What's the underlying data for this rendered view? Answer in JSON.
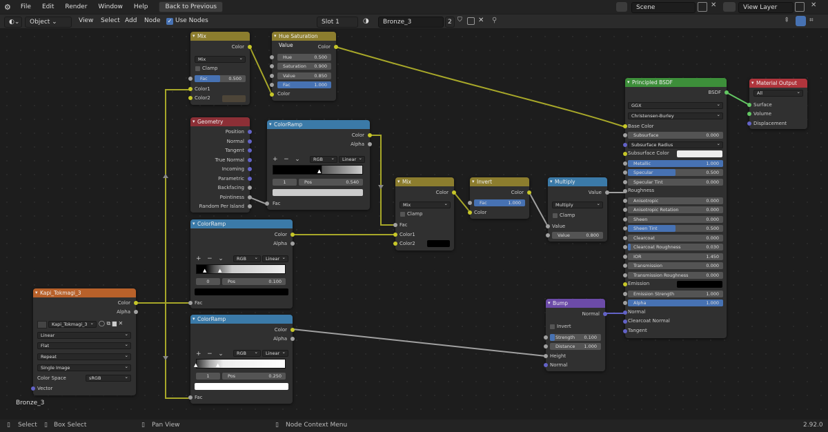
{
  "topbar": {
    "menus": [
      "File",
      "Edit",
      "Render",
      "Window",
      "Help"
    ],
    "back": "Back to Previous",
    "scene": "Scene",
    "view_layer": "View Layer"
  },
  "header": {
    "mode": "Object",
    "menus": [
      "View",
      "Select",
      "Add",
      "Node"
    ],
    "use_nodes": "Use Nodes",
    "slot": "Slot 1",
    "material": "Bronze_3",
    "users": "2"
  },
  "material_name": "Bronze_3",
  "status": {
    "select": "Select",
    "box_select": "Box Select",
    "pan_view": "Pan View",
    "context_menu": "Node Context Menu",
    "version": "2.92.0"
  },
  "colors": {
    "mix": "#8c7d2e",
    "ramp": "#3b7aa8",
    "geometry": "#8c2f36",
    "image": "#b8612a",
    "bsdf": "#3d8f3a",
    "output": "#b0353c",
    "bump": "#6c4ba8"
  },
  "nodes": {
    "mix1": {
      "title": "Mix",
      "color": "Color",
      "blend": "Mix",
      "clamp": "Clamp",
      "fac": "Fac",
      "fac_val": "0.500",
      "fac_frac": 0.5,
      "c1": "Color1",
      "c2": "Color2"
    },
    "hsv": {
      "title": "Hue Saturation Value",
      "color_out": "Color",
      "hue": "Hue",
      "hue_v": "0.500",
      "sat": "Saturation",
      "sat_v": "0.900",
      "val": "Value",
      "val_v": "0.850",
      "fac": "Fac",
      "fac_v": "1.000",
      "color_in": "Color"
    },
    "geo": {
      "title": "Geometry",
      "outs": [
        "Position",
        "Normal",
        "Tangent",
        "True Normal",
        "Incoming",
        "Parametric",
        "Backfacing",
        "Pointiness",
        "Random Per Island"
      ]
    },
    "ramp1": {
      "title": "ColorRamp",
      "color": "Color",
      "alpha": "Alpha",
      "mode": "RGB",
      "interp": "Linear",
      "idx": "1",
      "pos": "Pos",
      "pos_v": "0.540",
      "fac": "Fac"
    },
    "ramp2": {
      "title": "ColorRamp",
      "color": "Color",
      "alpha": "Alpha",
      "mode": "RGB",
      "interp": "Linear",
      "idx": "0",
      "pos": "Pos",
      "pos_v": "0.100",
      "fac": "Fac"
    },
    "ramp3": {
      "title": "ColorRamp",
      "color": "Color",
      "alpha": "Alpha",
      "mode": "RGB",
      "interp": "Linear",
      "idx": "1",
      "pos": "Pos",
      "pos_v": "0.250",
      "fac": "Fac"
    },
    "img": {
      "title": "Kapi_Tokmagi_3",
      "color": "Color",
      "alpha": "Alpha",
      "image": "Kapi_Tokmagi_3",
      "interp": "Linear",
      "proj": "Flat",
      "ext": "Repeat",
      "src": "Single Image",
      "cs_label": "Color Space",
      "cs": "sRGB",
      "vector": "Vector"
    },
    "mix2": {
      "title": "Mix",
      "color": "Color",
      "blend": "Mix",
      "clamp": "Clamp",
      "fac": "Fac",
      "c1": "Color1",
      "c2": "Color2"
    },
    "invert": {
      "title": "Invert",
      "color": "Color",
      "fac": "Fac",
      "fac_v": "1.000",
      "color_in": "Color"
    },
    "multiply": {
      "title": "Multiply",
      "value": "Value",
      "op": "Multiply",
      "clamp": "Clamp",
      "value_in": "Value",
      "value2": "Value",
      "value2_v": "0.800"
    },
    "bump": {
      "title": "Bump",
      "normal_out": "Normal",
      "invert": "Invert",
      "strength": "Strength",
      "strength_v": "0.100",
      "distance": "Distance",
      "distance_v": "1.000",
      "height": "Height",
      "normal": "Normal"
    },
    "bsdf": {
      "title": "Principled BSDF",
      "bsdf": "BSDF",
      "dist": "GGX",
      "sss": "Christensen-Burley",
      "base": "Base Color",
      "rows": [
        [
          "Subsurface",
          "0.000"
        ],
        [
          "Subsurface Radius",
          ""
        ],
        [
          "Subsurface Color",
          ""
        ],
        [
          "Metallic",
          "1.000"
        ],
        [
          "Specular",
          "0.500"
        ],
        [
          "Specular Tint",
          "0.000"
        ],
        [
          "Roughness",
          ""
        ],
        [
          "Anisotropic",
          "0.000"
        ],
        [
          "Anisotropic Rotation",
          "0.000"
        ],
        [
          "Sheen",
          "0.000"
        ],
        [
          "Sheen Tint",
          "0.500"
        ],
        [
          "Clearcoat",
          "0.000"
        ],
        [
          "Clearcoat Roughness",
          "0.030"
        ],
        [
          "IOR",
          "1.450"
        ],
        [
          "Transmission",
          "0.000"
        ],
        [
          "Transmission Roughness",
          "0.000"
        ],
        [
          "Emission",
          ""
        ],
        [
          "Emission Strength",
          "1.000"
        ],
        [
          "Alpha",
          "1.000"
        ],
        [
          "Normal",
          ""
        ],
        [
          "Clearcoat Normal",
          ""
        ],
        [
          "Tangent",
          ""
        ]
      ]
    },
    "out": {
      "title": "Material Output",
      "target": "All",
      "surface": "Surface",
      "volume": "Volume",
      "disp": "Displacement"
    }
  }
}
